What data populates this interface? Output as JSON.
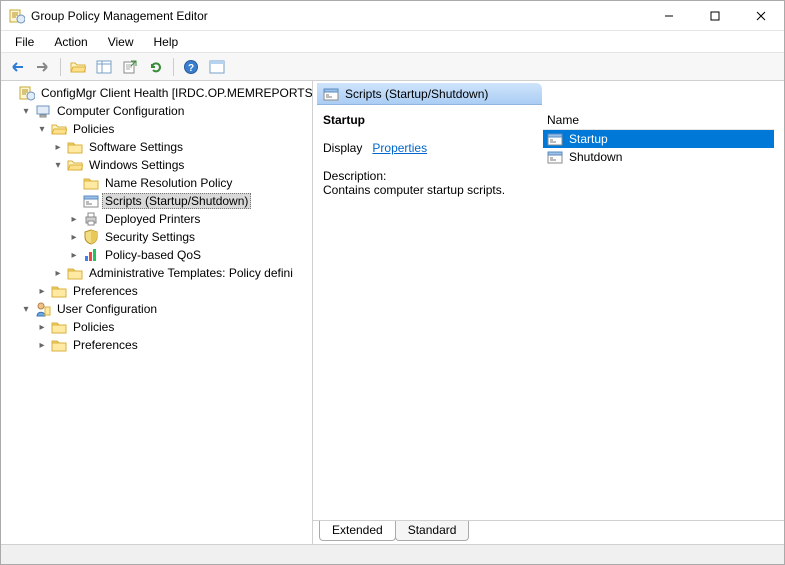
{
  "window": {
    "title": "Group Policy Management Editor"
  },
  "menu": {
    "file": "File",
    "action": "Action",
    "view": "View",
    "help": "Help"
  },
  "tree": {
    "root": "ConfigMgr Client Health [IRDC.OP.MEMREPORTS.",
    "computer_config": "Computer Configuration",
    "policies": "Policies",
    "software_settings": "Software Settings",
    "windows_settings": "Windows Settings",
    "name_resolution": "Name Resolution Policy",
    "scripts": "Scripts (Startup/Shutdown)",
    "deployed_printers": "Deployed Printers",
    "security_settings": "Security Settings",
    "policy_qos": "Policy-based QoS",
    "admin_templates": "Administrative Templates: Policy defini",
    "preferences": "Preferences",
    "user_config": "User Configuration",
    "policies2": "Policies",
    "preferences2": "Preferences"
  },
  "detail": {
    "header": "Scripts (Startup/Shutdown)",
    "heading": "Startup",
    "display_label": "Display",
    "properties_link": "Properties",
    "description_label": "Description:",
    "description_text": "Contains computer startup scripts.",
    "column_name": "Name",
    "rows": {
      "startup": "Startup",
      "shutdown": "Shutdown"
    },
    "tab_extended": "Extended",
    "tab_standard": "Standard"
  }
}
